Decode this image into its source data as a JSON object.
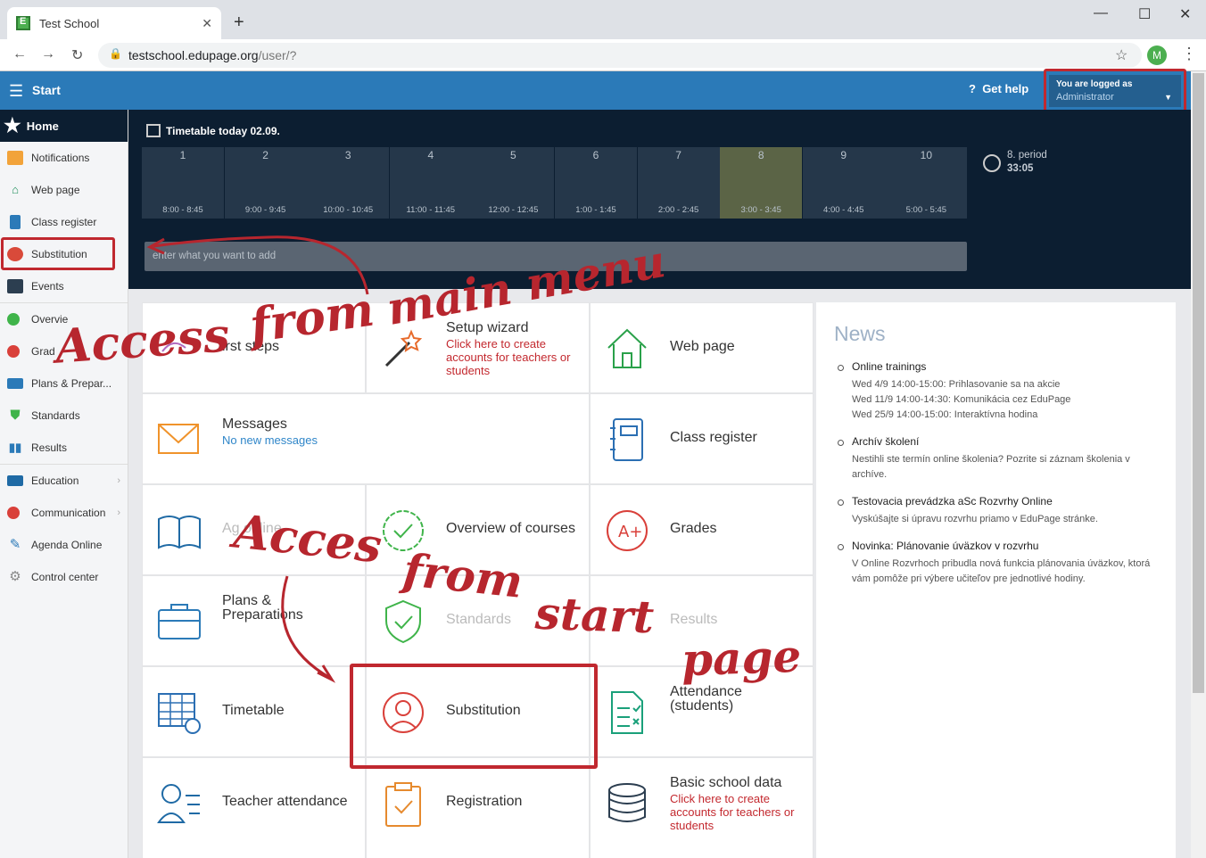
{
  "browser": {
    "tab_title": "Test School",
    "url_host": "testschool.edupage.org",
    "url_path": "/user/?",
    "profile_initial": "M"
  },
  "topbar": {
    "start_label": "Start",
    "help_label": "Get help",
    "logged_in_label": "You are logged as",
    "logged_in_user": "Administrator"
  },
  "sidebar": {
    "home_label": "Home",
    "items": [
      {
        "label": "Notifications"
      },
      {
        "label": "Web page"
      },
      {
        "label": "Class register"
      },
      {
        "label": "Substitution"
      },
      {
        "label": "Events"
      },
      {
        "label": "Overvie"
      },
      {
        "label": "Grad"
      },
      {
        "label": "Plans & Prepar..."
      },
      {
        "label": "Standards"
      },
      {
        "label": "Results"
      },
      {
        "label": "Education"
      },
      {
        "label": "Communication"
      },
      {
        "label": "Agenda Online"
      },
      {
        "label": "Control center"
      }
    ]
  },
  "timetable": {
    "title": "Timetable today 02.09.",
    "periods": [
      {
        "num": "1",
        "time": "8:00 - 8:45"
      },
      {
        "num": "2",
        "time": "9:00 - 9:45"
      },
      {
        "num": "3",
        "time": "10:00 - 10:45"
      },
      {
        "num": "4",
        "time": "11:00 - 11:45"
      },
      {
        "num": "5",
        "time": "12:00 - 12:45"
      },
      {
        "num": "6",
        "time": "1:00 - 1:45"
      },
      {
        "num": "7",
        "time": "2:00 - 2:45"
      },
      {
        "num": "8",
        "time": "3:00 - 3:45"
      },
      {
        "num": "9",
        "time": "4:00 - 4:45"
      },
      {
        "num": "10",
        "time": "5:00 - 5:45"
      }
    ],
    "current_period_label": "8. period",
    "countdown": "33:05",
    "add_placeholder": "enter what you want to add"
  },
  "tiles": {
    "first_steps": "irst steps",
    "setup_wizard": "Setup wizard",
    "setup_wizard_sub": "Click here to create accounts for teachers or students",
    "web_page": "Web page",
    "messages": "Messages",
    "messages_sub": "No new messages",
    "class_register": "Class register",
    "agenda_online": "Ag        online",
    "overview_courses": "Overview of courses",
    "grades": "Grades",
    "plans": "Plans & Preparations",
    "standards": "Standards",
    "results": "Results",
    "timetable": "Timetable",
    "substitution": "Substitution",
    "attendance_students": "Attendance (students)",
    "teacher_attendance": "Teacher attendance",
    "registration": "Registration",
    "basic_school_data": "Basic school data",
    "basic_school_data_sub": "Click here to create accounts for teachers or students"
  },
  "news": {
    "heading": "News",
    "items": [
      {
        "title": "Online trainings",
        "body": "Wed 4/9 14:00-15:00: Prihlasovanie sa na akcie\nWed 11/9 14:00-14:30: Komunikácia cez EduPage\nWed 25/9 14:00-15:00: Interaktívna hodina"
      },
      {
        "title": "Archív školení",
        "body": "Nestihli ste termín online školenia? Pozrite si záznam školenia v archíve."
      },
      {
        "title": "Testovacia prevádzka aSc Rozvrhy Online",
        "body": "Vyskúšajte si úpravu rozvrhu priamo v EduPage stránke."
      },
      {
        "title": "Novinka: Plánovanie úväzkov v rozvrhu",
        "body": "V Online Rozvrhoch pribudla nová funkcia plánovania úväzkov, ktorá vám pomôže pri výbere učiteľov pre jednotlivé hodiny."
      }
    ]
  },
  "annotations": {
    "access_main_1": "Access",
    "access_main_2": "from",
    "access_main_3": "main menu",
    "access_start_1": "Acces",
    "access_start_2": "from",
    "access_start_3": "start",
    "access_start_4": "page"
  },
  "colors": {
    "topbar": "#2b7ab8",
    "dark_panel": "#0c1e31",
    "annotation_red": "#b7262e"
  }
}
